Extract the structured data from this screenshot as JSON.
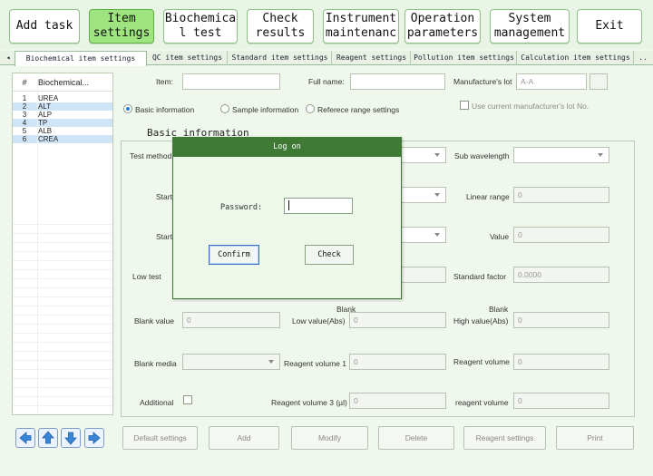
{
  "toolbar": {
    "buttons": [
      {
        "label": "Add task"
      },
      {
        "label": "Item\nsettings"
      },
      {
        "label": "Biochemica\nl test"
      },
      {
        "label": "Check\nresults"
      },
      {
        "label": "Instrument\nmaintenanc"
      },
      {
        "label": "Operation\nparameters"
      },
      {
        "label": "System\nmanagement"
      },
      {
        "label": "Exit"
      }
    ]
  },
  "tabs": [
    {
      "label": "Biochemical item settings"
    },
    {
      "label": "QC item settings"
    },
    {
      "label": "Standard item settings"
    },
    {
      "label": "Reagent settings"
    },
    {
      "label": "Pollution item settings"
    },
    {
      "label": "Calculation item settings"
    }
  ],
  "tab_scroll_left": "◂",
  "item_list": {
    "col_num": "#",
    "col_name": "Biochemical...",
    "rows": [
      {
        "num": "1",
        "name": "UREA"
      },
      {
        "num": "2",
        "name": "ALT"
      },
      {
        "num": "3",
        "name": "ALP"
      },
      {
        "num": "4",
        "name": "TP"
      },
      {
        "num": "5",
        "name": "ALB"
      },
      {
        "num": "6",
        "name": "CREA"
      }
    ]
  },
  "form": {
    "item_label": "Item:",
    "full_name_label": "Full name:",
    "manufacture_lot_label": "Manufacture's lot",
    "manufacture_lot_value": "A-A",
    "radio_basic": "Basic information",
    "radio_sample": "Sample information",
    "radio_range": "Referece range settings",
    "use_current_lot": "Use current manufacturer's lot No.",
    "section_title": "Basic information",
    "test_method": "Test method",
    "sub_wavelength": "Sub wavelength",
    "start1": "Start",
    "linear_range": "Linear range",
    "linear_range_value": "0",
    "start2": "Start",
    "value_label": "Value",
    "value_value": "0",
    "low_test": "Low test",
    "standard_factor": "Standard factor",
    "standard_factor_value": "0.0000",
    "blank_value_label": "Blank value",
    "blank_value": "0",
    "blank_low_top": "Blank",
    "low_value_abs": "Low value(Abs)",
    "low_value_abs_value": "0",
    "blank_high_top": "Blank",
    "high_value_abs": "High value(Abs)",
    "high_value_abs_value": "0",
    "blank_media": "Blank media",
    "reagent_volume_1": "Reagent volume 1",
    "reagent_volume_1_value": "0",
    "reagent_volume": "Reagent volume",
    "reagent_volume_value": "0",
    "additional": "Additional",
    "reagent_volume_3": "Reagent volume 3 (µl)",
    "reagent_volume_3_value": "0",
    "reagent_volume_lower": "reagent volume",
    "reagent_volume_lower_value": "0"
  },
  "bottom_buttons": [
    {
      "label": "Default settings"
    },
    {
      "label": "Add"
    },
    {
      "label": "Modify"
    },
    {
      "label": "Delete"
    },
    {
      "label": "Reagent settings"
    },
    {
      "label": "Print"
    }
  ],
  "nav_icons": [
    "arrow-left-icon",
    "arrow-up-icon",
    "arrow-down-icon",
    "arrow-right-icon"
  ],
  "dialog": {
    "title": "Log on",
    "password_label": "Password:",
    "password_value": "",
    "confirm_label": "Confirm",
    "check_label": "Check"
  },
  "colors": {
    "active_toolbar": "#9ee57f",
    "dialog_title": "#3f7a34",
    "selected_row": "#cfe5f7"
  }
}
